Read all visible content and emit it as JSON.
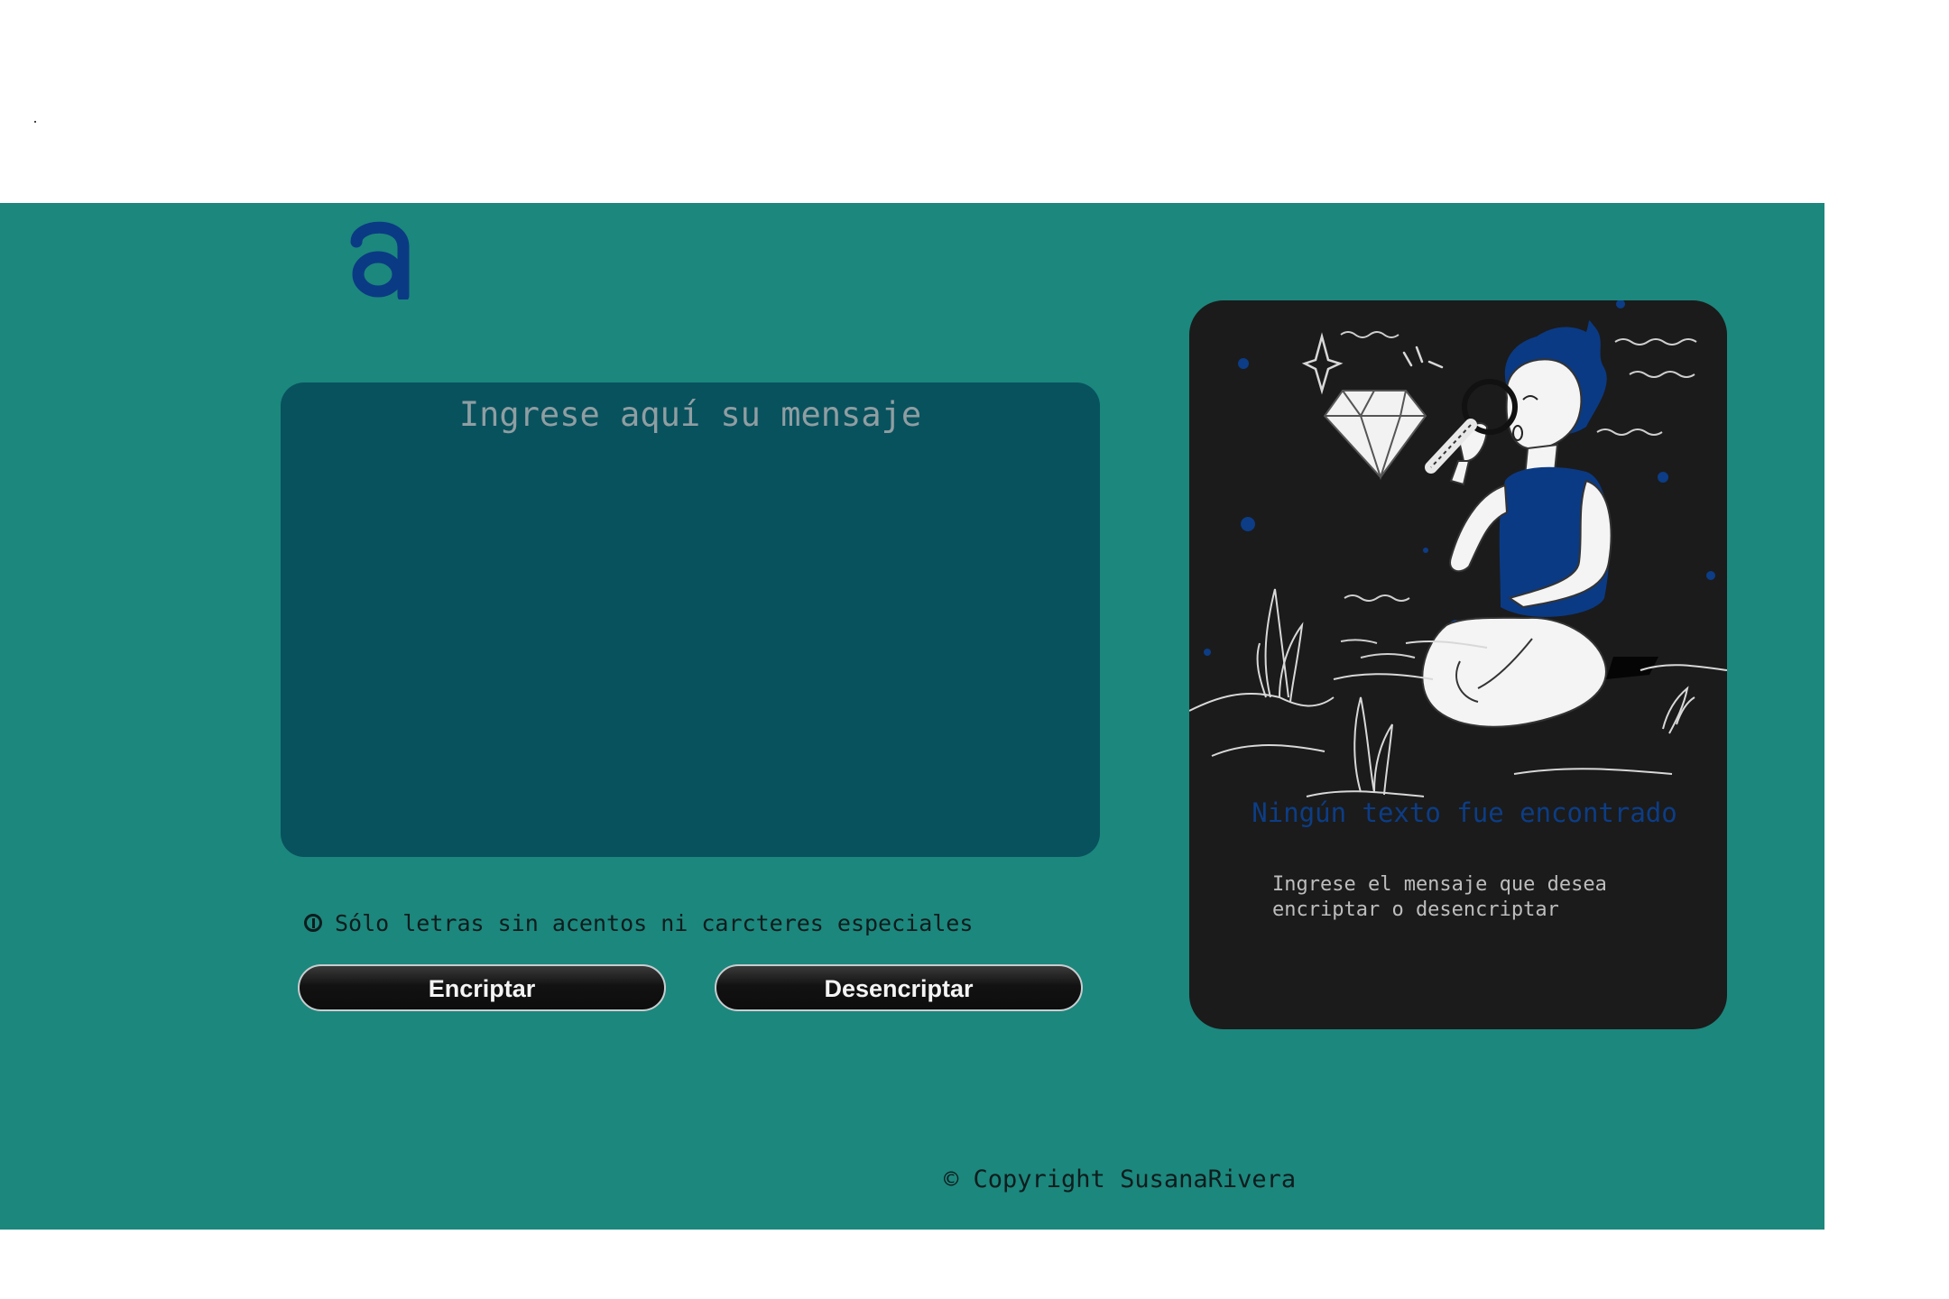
{
  "logo": {
    "letter": "a",
    "color": "#0b3a84"
  },
  "input": {
    "placeholder": "Ingrese aquí su mensaje",
    "value": ""
  },
  "hint": {
    "icon": "info-icon",
    "text": "Sólo letras sin acentos ni carcteres especiales"
  },
  "buttons": {
    "encrypt_label": "Encriptar",
    "decrypt_label": "Desencriptar"
  },
  "result_panel": {
    "illustration": "person-with-magnifying-glass-and-diamond",
    "title": "Ningún texto fue encontrado",
    "subtitle": "Ingrese el mensaje que desea encriptar o desencriptar"
  },
  "footer": {
    "text": "© Copyright SusanaRivera"
  },
  "colors": {
    "app_background": "#1c877d",
    "textarea_background": "#08525e",
    "card_background": "#1b1b1b",
    "accent_blue": "#0c3d86",
    "button_background": "#121212"
  }
}
